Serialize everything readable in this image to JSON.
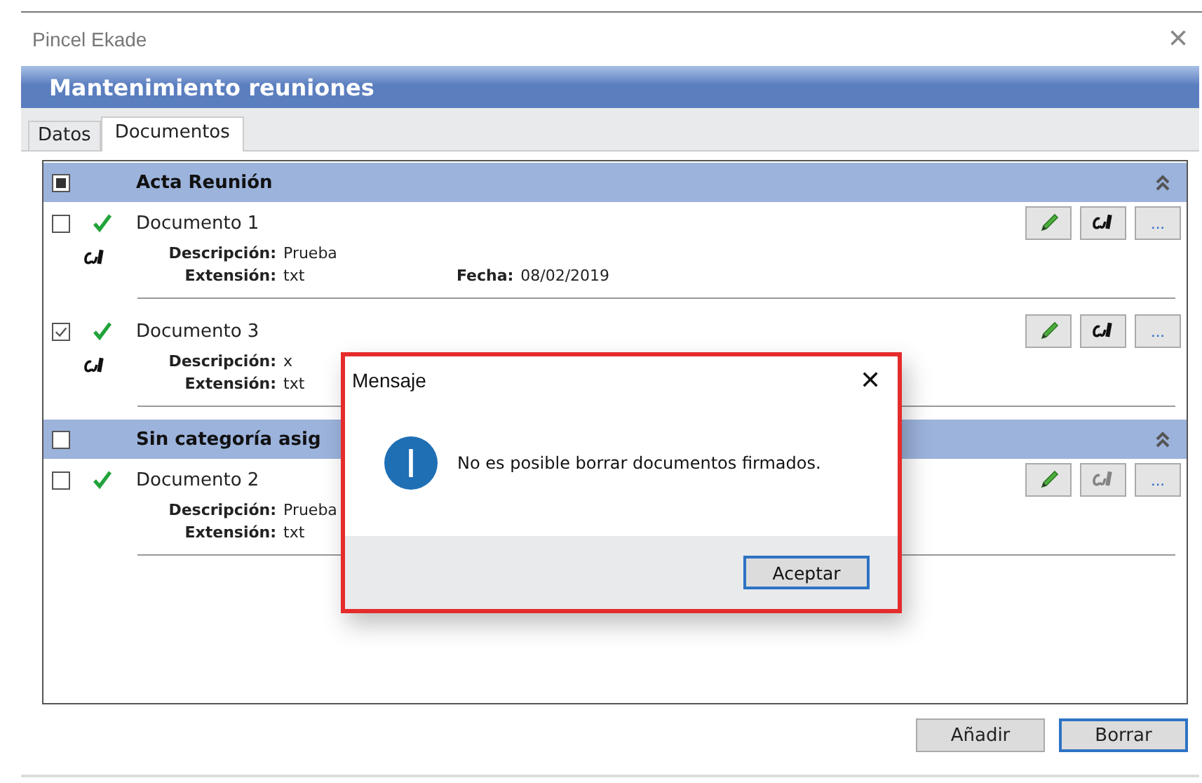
{
  "window": {
    "title": "Pincel Ekade",
    "close_label": "×"
  },
  "header": {
    "title": "Mantenimiento reuniones"
  },
  "tabs": [
    {
      "label": "Datos",
      "selected": false
    },
    {
      "label": "Documentos",
      "selected": true
    }
  ],
  "groups": [
    {
      "title": "Acta Reunión",
      "checked": false,
      "indeterminate": true,
      "documents": [
        {
          "name": "Documento 1",
          "checked": false,
          "signed": true,
          "has_signature": true,
          "sign_enabled": true,
          "more_label": "...",
          "fields": [
            {
              "label": "Descripción:",
              "value": "Prueba"
            },
            {
              "label": "Extensión:",
              "value": "txt"
            }
          ],
          "date": {
            "label": "Fecha:",
            "value": "08/02/2019"
          }
        },
        {
          "name": "Documento 3",
          "checked": true,
          "signed": true,
          "has_signature": true,
          "sign_enabled": true,
          "more_label": "...",
          "fields": [
            {
              "label": "Descripción:",
              "value": "x"
            },
            {
              "label": "Extensión:",
              "value": "txt"
            }
          ]
        }
      ]
    },
    {
      "title": "Sin categoría asig",
      "checked": false,
      "indeterminate": false,
      "documents": [
        {
          "name": "Documento 2",
          "checked": false,
          "signed": true,
          "has_signature": false,
          "sign_enabled": false,
          "more_label": "...",
          "fields": [
            {
              "label": "Descripción:",
              "value": "Prueba"
            },
            {
              "label": "Extensión:",
              "value": "txt"
            }
          ]
        }
      ]
    }
  ],
  "buttons": [
    {
      "label": "Añadir",
      "focused": false
    },
    {
      "label": "Borrar",
      "focused": true
    }
  ],
  "dialog": {
    "title": "Mensaje",
    "close_label": "✕",
    "message": "No es posible borrar documentos firmados.",
    "button": "Aceptar"
  }
}
